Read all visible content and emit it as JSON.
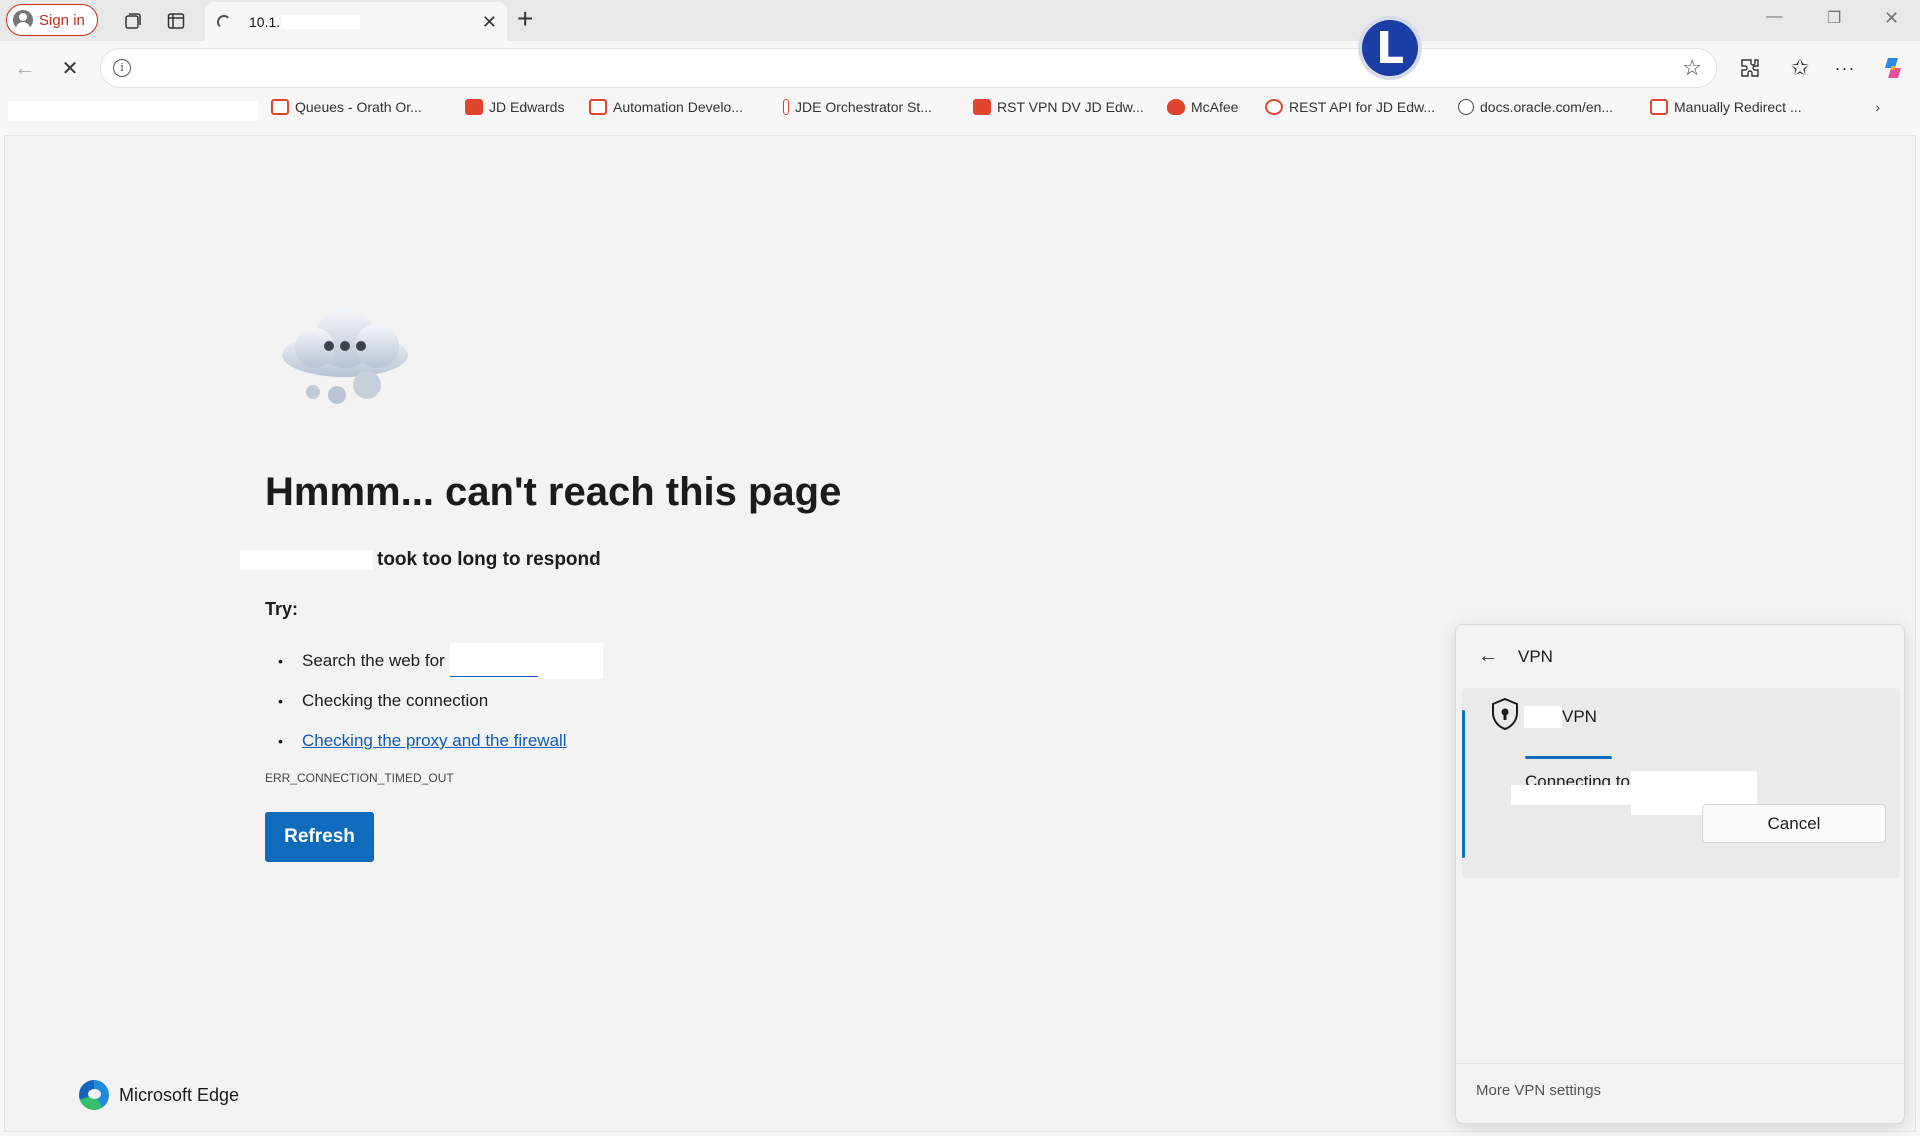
{
  "tabbar": {
    "signin_label": "Sign in",
    "active_tab_title": "10.1.",
    "tab_icons": [
      "collections-icon",
      "vertical-tabs-icon"
    ],
    "window_controls": [
      "minimize-icon",
      "restore-icon",
      "close-icon"
    ]
  },
  "navbar": {
    "address_value": "",
    "profile_letter": "L",
    "right_icons": [
      "extensions-icon",
      "favorites-icon",
      "more-icon",
      "copilot-icon"
    ]
  },
  "favorites": [
    {
      "label": "Queues - Orath Or...",
      "icon": "queue-icon"
    },
    {
      "label": "JD Edwards",
      "icon": "jde-icon"
    },
    {
      "label": "Automation Develo...",
      "icon": "automation-icon"
    },
    {
      "label": "JDE Orchestrator St...",
      "icon": "orchestrator-icon"
    },
    {
      "label": "RST VPN DV JD Edw...",
      "icon": "vpn-bookmark-icon"
    },
    {
      "label": "McAfee",
      "icon": "mcafee-icon"
    },
    {
      "label": "REST API for JD Edw...",
      "icon": "api-icon"
    },
    {
      "label": "docs.oracle.com/en...",
      "icon": "globe-icon"
    },
    {
      "label": "Manually Redirect ...",
      "icon": "redirect-icon"
    }
  ],
  "error_page": {
    "heading": "Hmmm... can't reach this page",
    "subline": "took too long to respond",
    "try_label": "Try:",
    "suggestions": {
      "search_prefix": "Search the web for",
      "connection": "Checking the connection",
      "proxy_firewall": "Checking the proxy and the firewall"
    },
    "error_code": "ERR_CONNECTION_TIMED_OUT",
    "refresh_label": "Refresh",
    "brand": "Microsoft Edge"
  },
  "vpn": {
    "title": "VPN",
    "connection_name": "VPN",
    "status": "Connecting to",
    "cancel_label": "Cancel",
    "more_settings": "More VPN settings",
    "accent_color": "#0f6cbd"
  }
}
